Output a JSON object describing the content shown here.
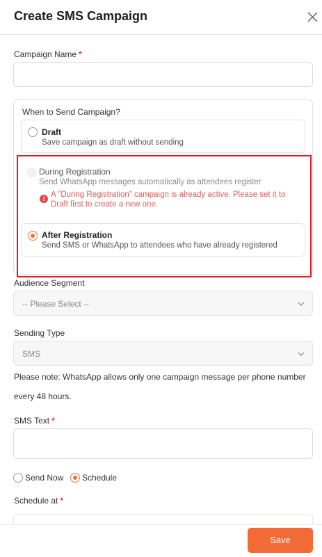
{
  "dialog": {
    "title": "Create SMS Campaign",
    "close_icon": "close-icon"
  },
  "campaign_name": {
    "label": "Campaign Name",
    "required_mark": "*",
    "value": ""
  },
  "when_to_send": {
    "label": "When to Send Campaign?",
    "options": [
      {
        "title": "Draft",
        "description": "Save campaign as draft without sending",
        "selected": false,
        "disabled": false
      },
      {
        "title": "During Registration",
        "description": "Send WhatsApp messages automatically as attendees register",
        "selected": false,
        "disabled": true,
        "warning": "A \"During Registration\" campaign is already active. Please set it to Draft first to create a new one."
      },
      {
        "title": "After Registration",
        "description": "Send SMS or WhatsApp to attendees who have already registered",
        "selected": true,
        "disabled": false
      }
    ]
  },
  "audience_segment": {
    "label": "Audience Segment",
    "value": "-- Please Select --"
  },
  "sending_type": {
    "label": "Sending Type",
    "value": "SMS"
  },
  "note": "Please note: WhatsApp allows only one campaign message per phone number every 48 hours.",
  "sms_text": {
    "label": "SMS Text",
    "required_mark": "*",
    "value": ""
  },
  "send_mode": {
    "options": [
      "Send Now",
      "Schedule"
    ],
    "selected": "Schedule"
  },
  "schedule_at": {
    "label": "Schedule at",
    "required_mark": "*"
  },
  "footer": {
    "save_label": "Save"
  },
  "colors": {
    "accent": "#f26a35",
    "highlight_border": "#e01b24",
    "warning_text": "#e05a5a"
  }
}
